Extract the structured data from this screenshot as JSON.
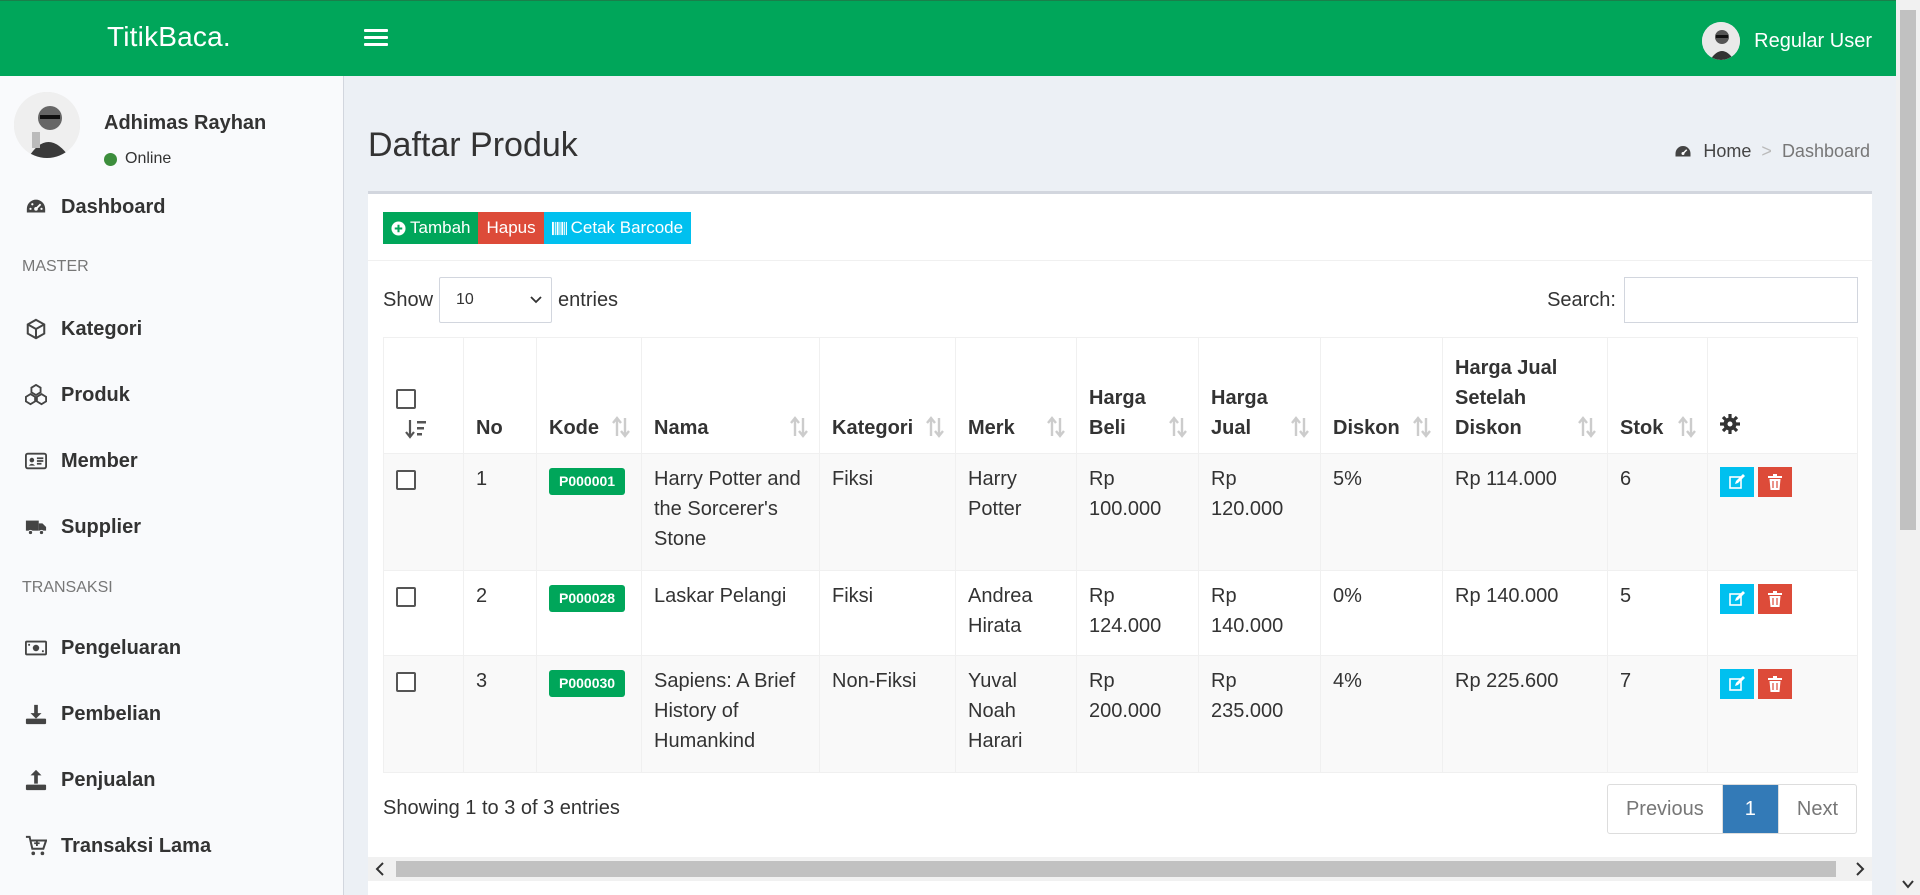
{
  "app": {
    "brand": "TitikBaca."
  },
  "header": {
    "user_name": "Regular User"
  },
  "sidebar": {
    "user": {
      "name": "Adhimas Rayhan",
      "status": "Online"
    },
    "items": [
      {
        "label": "Dashboard",
        "icon": "dashboard-icon"
      },
      {
        "label": "Kategori",
        "icon": "cube-icon"
      },
      {
        "label": "Produk",
        "icon": "cubes-icon"
      },
      {
        "label": "Member",
        "icon": "id-card-icon"
      },
      {
        "label": "Supplier",
        "icon": "truck-icon"
      },
      {
        "label": "Pengeluaran",
        "icon": "money-icon"
      },
      {
        "label": "Pembelian",
        "icon": "download-icon"
      },
      {
        "label": "Penjualan",
        "icon": "upload-icon"
      },
      {
        "label": "Transaksi Lama",
        "icon": "cart-icon"
      }
    ],
    "headers": {
      "master": "MASTER",
      "transaksi": "TRANSAKSI"
    }
  },
  "page": {
    "title": "Daftar Produk",
    "breadcrumb": {
      "home": "Home",
      "current": "Dashboard"
    }
  },
  "toolbar": {
    "add_label": "Tambah",
    "delete_label": "Hapus",
    "barcode_label": "Cetak Barcode"
  },
  "table_controls": {
    "show_label": "Show",
    "entries_value": "10",
    "entries_label": "entries",
    "search_label": "Search:"
  },
  "table": {
    "columns": [
      "No",
      "Kode",
      "Nama",
      "Kategori",
      "Merk",
      "Harga Beli",
      "Harga Jual",
      "Diskon",
      "Harga Jual Setelah Diskon",
      "Stok"
    ],
    "rows": [
      {
        "no": "1",
        "kode": "P000001",
        "nama": "Harry Potter and the Sorcerer's Stone",
        "kategori": "Fiksi",
        "merk": "Harry Potter",
        "harga_beli": "Rp 100.000",
        "harga_jual": "Rp 120.000",
        "diskon": "5%",
        "harga_setelah": "Rp 114.000",
        "stok": "6"
      },
      {
        "no": "2",
        "kode": "P000028",
        "nama": "Laskar Pelangi",
        "kategori": "Fiksi",
        "merk": "Andrea Hirata",
        "harga_beli": "Rp 124.000",
        "harga_jual": "Rp 140.000",
        "diskon": "0%",
        "harga_setelah": "Rp 140.000",
        "stok": "5"
      },
      {
        "no": "3",
        "kode": "P000030",
        "nama": "Sapiens: A Brief History of Humankind",
        "kategori": "Non-Fiksi",
        "merk": "Yuval Noah Harari",
        "harga_beli": "Rp 200.000",
        "harga_jual": "Rp 235.000",
        "diskon": "4%",
        "harga_setelah": "Rp 225.600",
        "stok": "7"
      }
    ]
  },
  "footer": {
    "info": "Showing 1 to 3 of 3 entries",
    "prev": "Previous",
    "page": "1",
    "next": "Next"
  },
  "colors": {
    "primary": "#00a65a",
    "danger": "#dd4b39",
    "info": "#00c0ef",
    "pager_active": "#337ab7"
  }
}
